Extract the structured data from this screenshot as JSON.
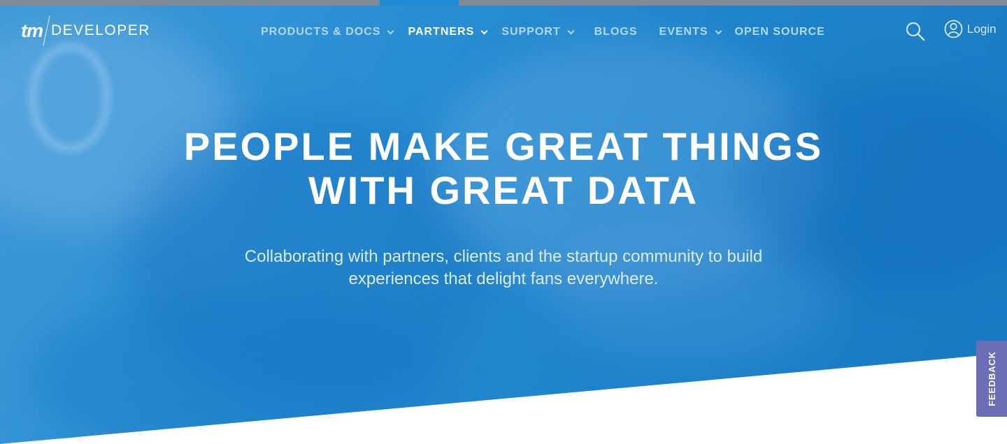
{
  "brand": {
    "logo_mark": "tm",
    "logo_text": "DEVELOPER"
  },
  "nav": {
    "items": [
      {
        "label": "PRODUCTS & DOCS",
        "has_dropdown": true,
        "active": false
      },
      {
        "label": "PARTNERS",
        "has_dropdown": true,
        "active": true
      },
      {
        "label": "SUPPORT",
        "has_dropdown": true,
        "active": false
      },
      {
        "label": "BLOGS",
        "has_dropdown": false,
        "active": false
      },
      {
        "label": "EVENTS",
        "has_dropdown": true,
        "active": false
      },
      {
        "label": "OPEN SOURCE",
        "has_dropdown": false,
        "active": false
      }
    ]
  },
  "header": {
    "search_icon": "search-icon",
    "login_icon": "user-circle-icon",
    "login_label": "Login"
  },
  "hero": {
    "headline_line1": "PEOPLE MAKE GREAT THINGS",
    "headline_line2": "WITH GREAT DATA",
    "sub_line1": "Collaborating with partners, clients and the startup community to build",
    "sub_line2": "experiences that delight fans everywhere."
  },
  "feedback": {
    "label": "FEEDBACK"
  },
  "colors": {
    "hero_blue": "#2a8ed3",
    "nav_inactive": "#b3d9f6",
    "feedback_bg": "#6b6eb5",
    "top_strip": "#7f8b94"
  }
}
